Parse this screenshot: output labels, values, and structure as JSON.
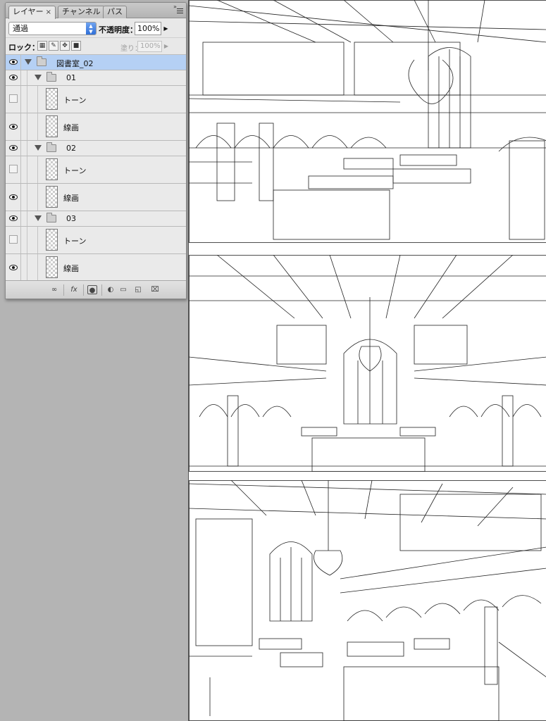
{
  "panel": {
    "tabs": [
      {
        "label": "レイヤー",
        "close": "×"
      },
      {
        "label": "チャンネル"
      },
      {
        "label": "パス"
      }
    ],
    "blend_mode": "通過",
    "opacity_label": "不透明度：",
    "opacity_value": "100%",
    "lock_label": "ロック：",
    "fill_label": "塗り：",
    "fill_value": "100%",
    "layers": [
      {
        "name": "図書室_02",
        "kind": "group",
        "visible": true,
        "selected": true
      },
      {
        "name": "01",
        "kind": "group",
        "visible": true
      },
      {
        "name": "トーン",
        "kind": "layer",
        "visible": false
      },
      {
        "name": "線画",
        "kind": "layer",
        "visible": true
      },
      {
        "name": "02",
        "kind": "group",
        "visible": true
      },
      {
        "name": "トーン",
        "kind": "layer",
        "visible": false
      },
      {
        "name": "線画",
        "kind": "layer",
        "visible": true
      },
      {
        "name": "03",
        "kind": "group",
        "visible": true
      },
      {
        "name": "トーン",
        "kind": "layer",
        "visible": false
      },
      {
        "name": "線画",
        "kind": "layer",
        "visible": true
      }
    ],
    "bottom_icons": [
      "link-icon",
      "fx-icon",
      "mask-icon",
      "adjustment-icon",
      "new-group-icon",
      "new-layer-icon",
      "trash-icon"
    ]
  },
  "canvas": {
    "panels": [
      "library-interior-line-art-1",
      "library-interior-line-art-2",
      "library-interior-line-art-3"
    ]
  }
}
